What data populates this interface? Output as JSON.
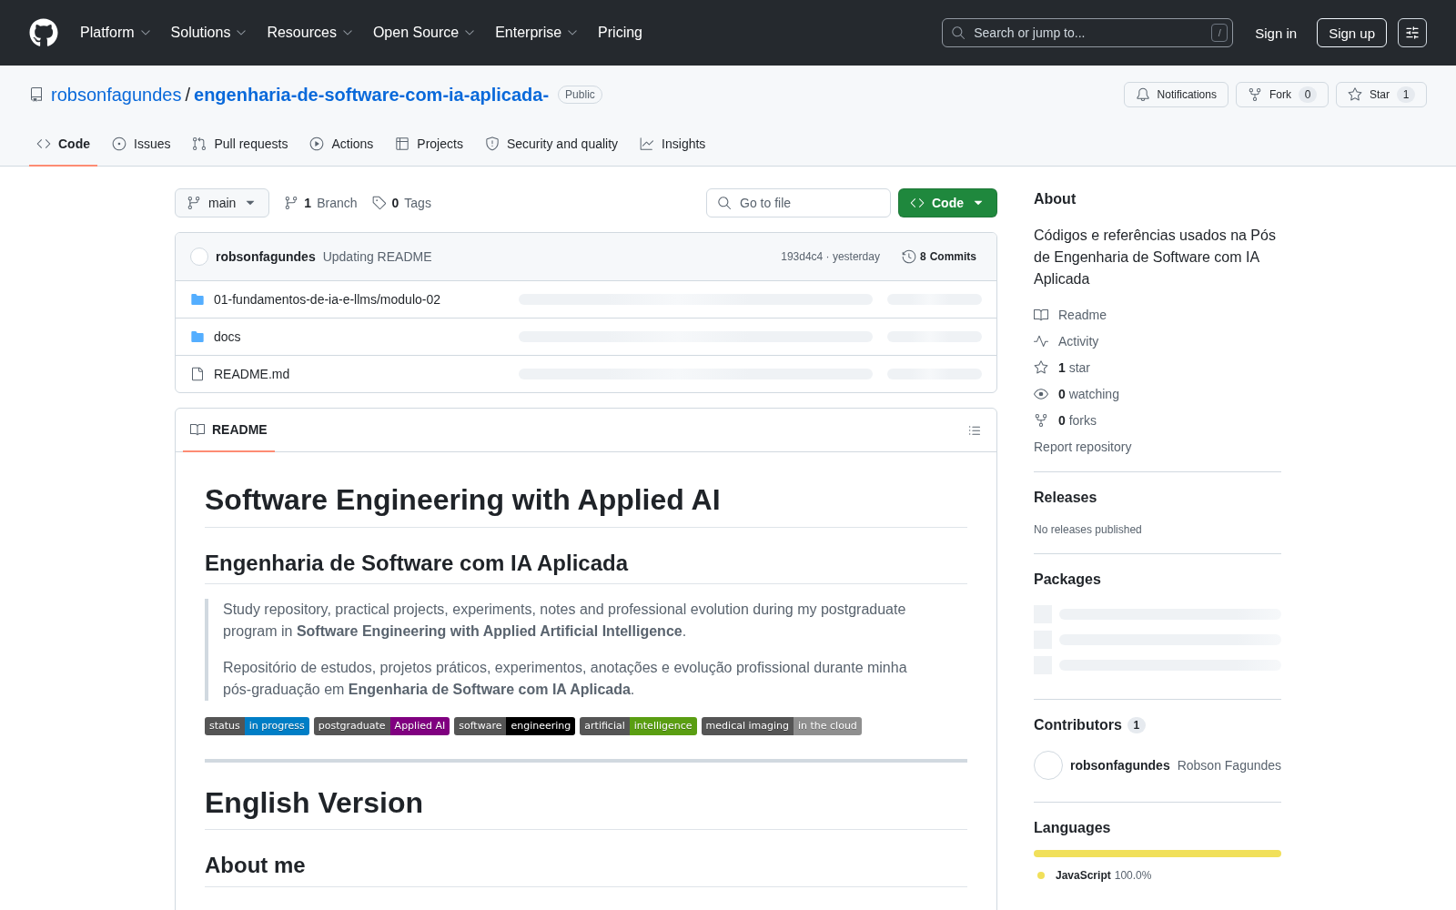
{
  "header": {
    "nav": [
      {
        "label": "Platform",
        "has_menu": true
      },
      {
        "label": "Solutions",
        "has_menu": true
      },
      {
        "label": "Resources",
        "has_menu": true
      },
      {
        "label": "Open Source",
        "has_menu": true
      },
      {
        "label": "Enterprise",
        "has_menu": true
      },
      {
        "label": "Pricing",
        "has_menu": false
      }
    ],
    "search": {
      "placeholder": "Search or jump to...",
      "shortcut": "/"
    },
    "sign_in": "Sign in",
    "sign_up": "Sign up"
  },
  "repo": {
    "owner": "robsonfagundes",
    "separator": "/",
    "name": "engenharia-de-software-com-ia-aplicada-",
    "visibility": "Public",
    "actions": [
      {
        "kind": "notifications",
        "label": "Notifications"
      },
      {
        "kind": "fork",
        "label": "Fork",
        "count": "0"
      },
      {
        "kind": "star",
        "label": "Star",
        "count": "1"
      }
    ]
  },
  "tabs": [
    {
      "kind": "code",
      "label": "Code",
      "selected": true
    },
    {
      "kind": "issues",
      "label": "Issues",
      "selected": false
    },
    {
      "kind": "pulls",
      "label": "Pull requests",
      "selected": false
    },
    {
      "kind": "actions",
      "label": "Actions",
      "selected": false
    },
    {
      "kind": "projects",
      "label": "Projects",
      "selected": false
    },
    {
      "kind": "security",
      "label": "Security and quality",
      "selected": false
    },
    {
      "kind": "insights",
      "label": "Insights",
      "selected": false
    }
  ],
  "toolbar": {
    "branch": "main",
    "refs": [
      {
        "kind": "branches",
        "count": "1",
        "label": "Branch"
      },
      {
        "kind": "tags",
        "count": "0",
        "label": "Tags"
      }
    ],
    "file_search": {
      "placeholder": "Go to file"
    },
    "code_button": "Code"
  },
  "latest_commit": {
    "author": "robsonfagundes",
    "message": "Updating README",
    "meta": "193d4c4 · yesterday",
    "commits": {
      "count": "8",
      "label": "Commits"
    }
  },
  "files": [
    {
      "kind": "folder",
      "name": "01-fundamentos-de-ia-e-llms/modulo-02"
    },
    {
      "kind": "folder",
      "name": "docs"
    },
    {
      "kind": "file",
      "name": "README.md"
    }
  ],
  "readme": {
    "tab": "README",
    "content": [
      {
        "kind": "h1",
        "text": "Software Engineering with Applied AI"
      },
      {
        "kind": "h2",
        "text": "Engenharia de Software com IA Aplicada"
      },
      {
        "kind": "quote",
        "paragraphs": [
          "Study repository, practical projects, experiments, notes and professional evolution during my postgraduate program in **Software Engineering with Applied Artificial Intelligence**.",
          "Repositório de estudos, projetos práticos, experimentos, anotações e evolução profissional durante minha pós-graduação em **Engenharia de Software com IA Aplicada**."
        ]
      },
      {
        "kind": "badges",
        "items": [
          {
            "label": "status",
            "message": "in progress",
            "color": "#007ec6"
          },
          {
            "label": "postgraduate",
            "message": "Applied AI",
            "color": "#800080"
          },
          {
            "label": "software",
            "message": "engineering",
            "color": "#000000"
          },
          {
            "label": "artificial",
            "message": "intelligence",
            "color": "#5a9e12"
          },
          {
            "label": "medical imaging",
            "message": "in the cloud",
            "color": "#8f8f8f"
          }
        ]
      },
      {
        "kind": "rule"
      },
      {
        "kind": "h1",
        "text": "English Version"
      },
      {
        "kind": "h2",
        "text": "About me"
      }
    ]
  },
  "sidebar": {
    "about": {
      "title": "About",
      "description": "Códigos e referências usados na Pós de Engenharia de Software com IA Aplicada",
      "links": [
        {
          "kind": "readme",
          "label": "Readme"
        },
        {
          "kind": "activity",
          "label": "Activity"
        },
        {
          "kind": "stars",
          "count": "1",
          "label": "star"
        },
        {
          "kind": "watchers",
          "count": "0",
          "label": "watching"
        },
        {
          "kind": "forks",
          "count": "0",
          "label": "forks"
        }
      ],
      "report": "Report repository"
    },
    "releases": {
      "title": "Releases",
      "note": "No releases published"
    },
    "packages": {
      "title": "Packages"
    },
    "contributors": {
      "title": "Contributors",
      "count": "1",
      "people": [
        {
          "login": "robsonfagundes",
          "name": "Robson Fagundes"
        }
      ]
    },
    "languages": {
      "title": "Languages",
      "items": [
        {
          "name": "JavaScript",
          "percent": "100.0%",
          "color": "#f1e05a"
        }
      ]
    }
  }
}
